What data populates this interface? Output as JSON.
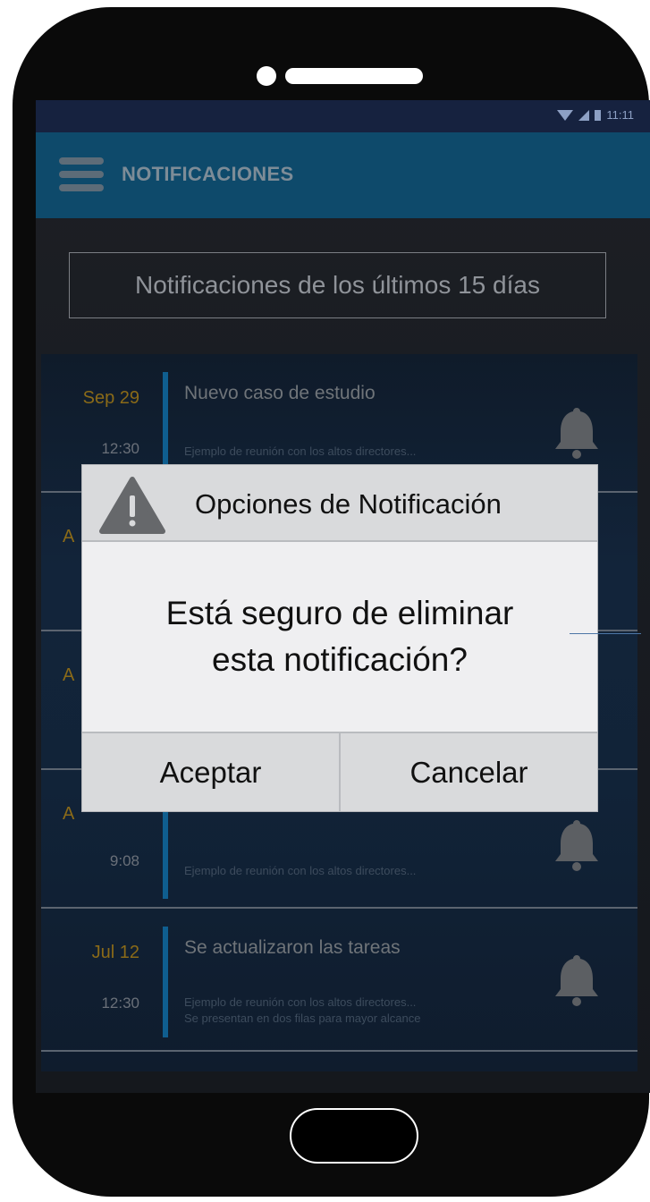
{
  "status_bar": {
    "time": "11:11"
  },
  "app_bar": {
    "title": "NOTIFICACIONES",
    "menu_icon": "hamburger-menu-icon"
  },
  "filter": {
    "label": "Notificaciones de los últimos 15 días"
  },
  "notifications": [
    {
      "date": "Sep 29",
      "time": "12:30",
      "title": "Nuevo caso de estudio",
      "desc_line1": "Ejemplo de reunión con los altos directores...",
      "desc_line2": ""
    },
    {
      "date": "A",
      "time": "",
      "title": "",
      "desc_line1": "",
      "desc_line2": ""
    },
    {
      "date": "A",
      "time": "",
      "title": "",
      "desc_line1": "",
      "desc_line2": ""
    },
    {
      "date": "A",
      "time": "9:08",
      "title": "",
      "desc_line1": "Ejemplo de reunión con los altos directores...",
      "desc_line2": ""
    },
    {
      "date": "Jul 12",
      "time": "12:30",
      "title": "Se actualizaron las tareas",
      "desc_line1": "Ejemplo de reunión con los altos directores...",
      "desc_line2": "Se presentan en dos filas para mayor alcance"
    }
  ],
  "dialog": {
    "title": "Opciones de Notificación",
    "message_line1": "Está seguro de eliminar",
    "message_line2": "esta notificación?",
    "accept_label": "Aceptar",
    "cancel_label": "Cancelar",
    "icon": "warning-icon"
  },
  "colors": {
    "app_bar": "#0e4a6b",
    "status_bar": "#16223f",
    "date_accent": "#8a6a18",
    "notif_bar": "#0f5e8f",
    "dialog_bg": "#efeff1",
    "dialog_header": "#d9dadc"
  }
}
